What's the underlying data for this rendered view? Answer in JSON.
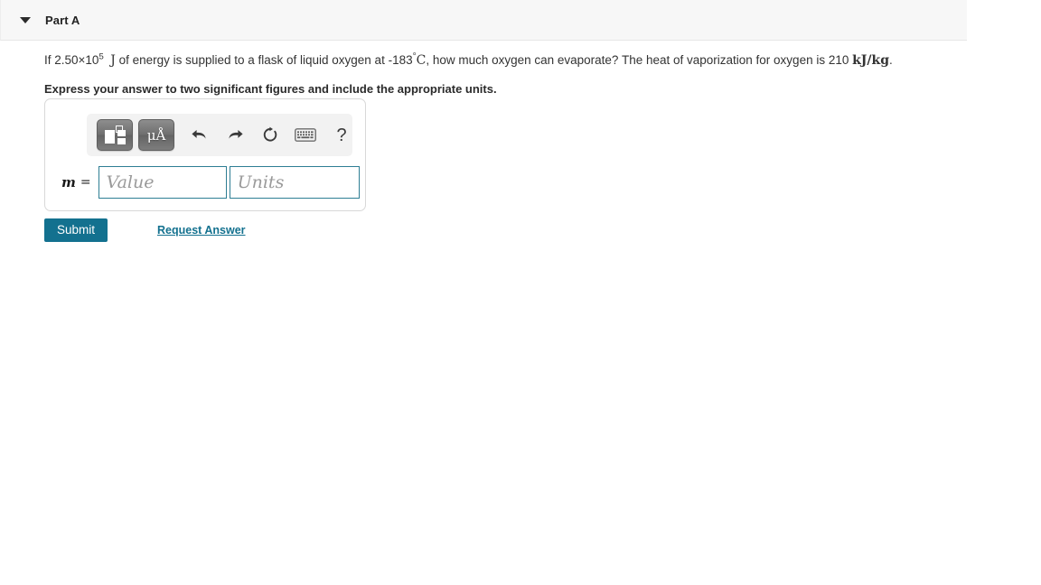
{
  "part": {
    "title": "Part A",
    "caret_icon": "chevron-down-icon",
    "expanded": true
  },
  "question": {
    "prefix": "If ",
    "coefficient": "2.50×10",
    "exponent": "5",
    "energy_unit": "J",
    "middle": " of energy is supplied to a flask of liquid oxygen at -183",
    "degree": "°",
    "temp_unit": "C",
    "after_temp": ", how much oxygen can evaporate? The heat of vaporization for oxygen is 210 ",
    "enthalpy_unit": "kJ/kg",
    "end": ".",
    "instruction": "Express your answer to two significant figures and include the appropriate units."
  },
  "answer_widget": {
    "toolbar": {
      "template_button": {
        "icon": "math-template-icon",
        "label": ""
      },
      "units_button": {
        "icon": "greek-units-icon",
        "label": "μÅ"
      },
      "undo_button": {
        "icon": "undo-arrow-icon"
      },
      "redo_button": {
        "icon": "redo-arrow-icon"
      },
      "reset_button": {
        "icon": "reset-circular-arrow-icon"
      },
      "keyboard_button": {
        "icon": "keyboard-icon"
      },
      "help_button": {
        "icon": "question-mark-icon",
        "label": "?"
      }
    },
    "variable_label": "m",
    "equals_sign": "=",
    "value_input": {
      "placeholder": "Value",
      "value": ""
    },
    "units_input": {
      "placeholder": "Units",
      "value": ""
    }
  },
  "actions": {
    "submit_label": "Submit",
    "request_answer_label": "Request Answer"
  },
  "colors": {
    "accent_teal": "#13718f",
    "input_border_teal": "#2e7e94",
    "header_background": "#f7f7f7",
    "toolbar_background": "#f2f2f2"
  }
}
